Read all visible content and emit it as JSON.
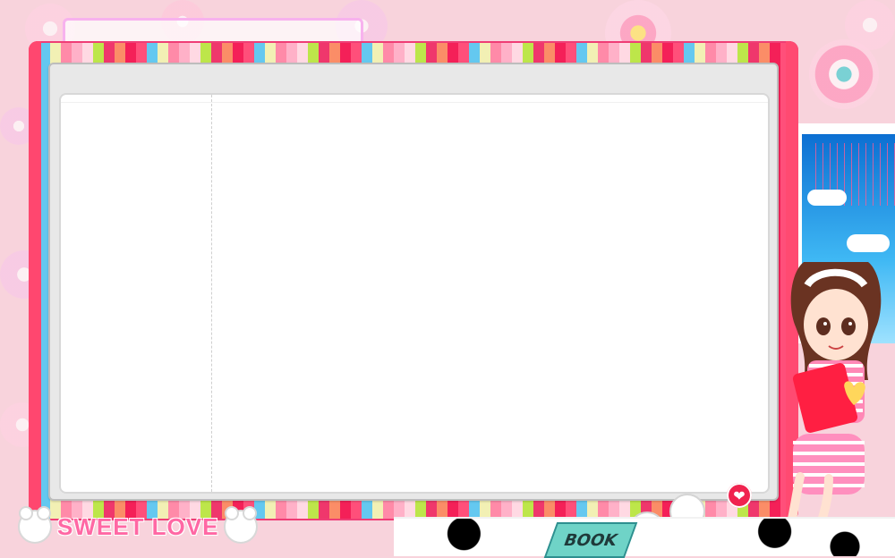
{
  "app": {
    "title": "",
    "logo_text": "SWEET LOVE",
    "book_label": "BOOK"
  },
  "colors": {
    "background": "#f8d3dc",
    "title_border": "#f7b2ee",
    "frame_pink": "#ff476f",
    "panel_gray": "#e8e8e8",
    "paper": "#ffffff",
    "logo_text": "#ff68a4",
    "heart_red": "#f0234f"
  },
  "icons": {
    "heart_bubble": "heart-icon",
    "bear": "bear-icon"
  }
}
